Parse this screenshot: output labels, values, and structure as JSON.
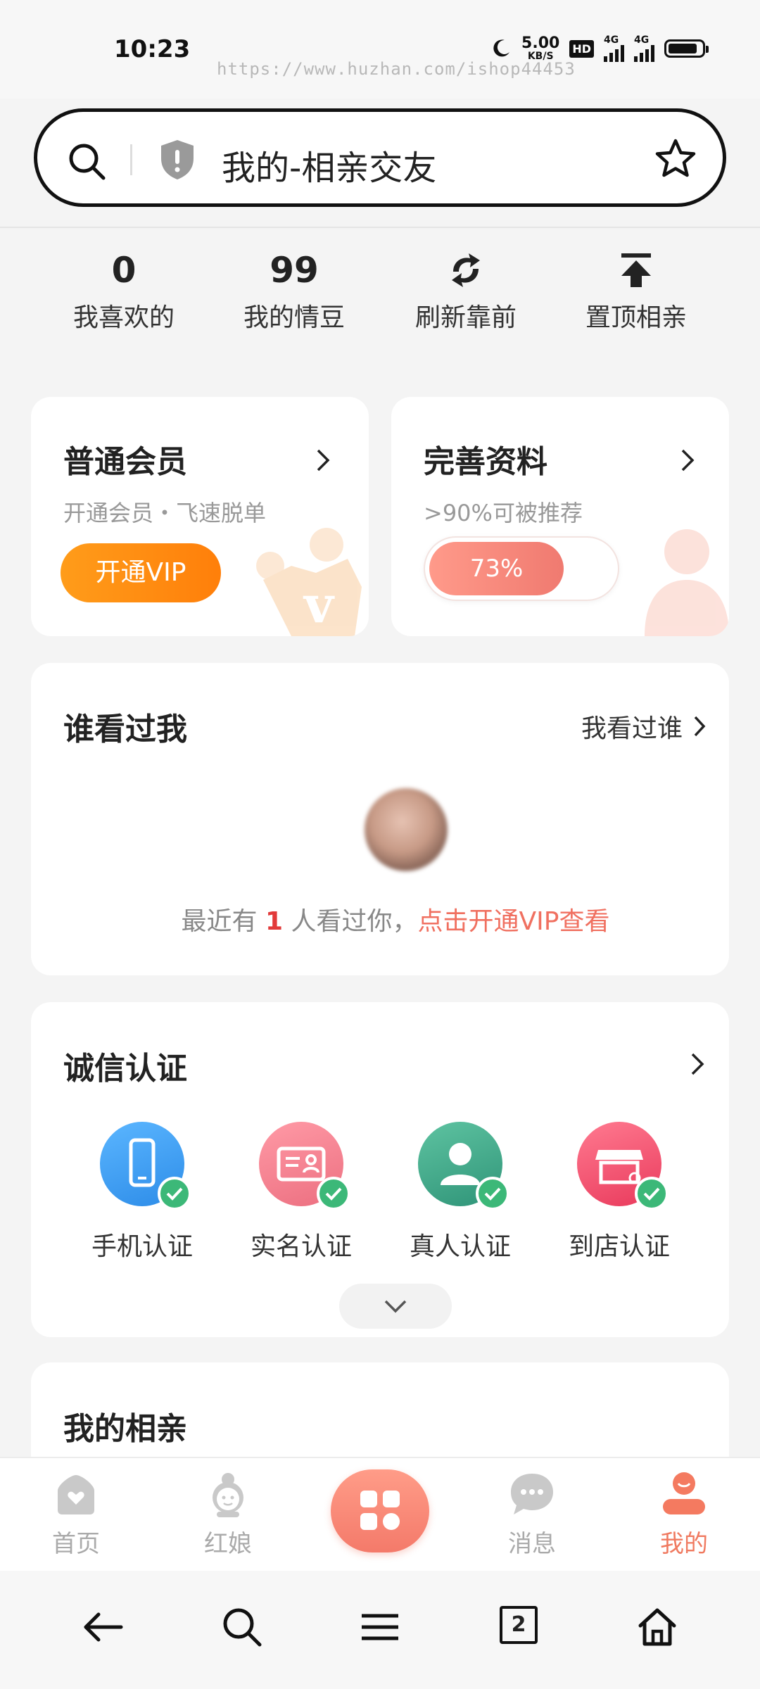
{
  "status": {
    "time": "10:23",
    "speed_value": "5.00",
    "speed_unit": "KB/S",
    "hd": "HD",
    "net1": "4G",
    "net2": "4G",
    "watermark": "https://www.huzhan.com/ishop44453"
  },
  "search": {
    "page_title": "我的-相亲交友",
    "icons": [
      "search-icon",
      "shield-icon",
      "star-icon"
    ]
  },
  "stats": [
    {
      "value": "0",
      "label": "我喜欢的"
    },
    {
      "value": "99",
      "label": "我的情豆"
    },
    {
      "icon": "refresh-icon",
      "label": "刷新靠前"
    },
    {
      "icon": "pin-top-icon",
      "label": "置顶相亲"
    }
  ],
  "membership": {
    "title": "普通会员",
    "subtitle": "开通会员・飞速脱单",
    "button": "开通VIP"
  },
  "profile": {
    "title": "完善资料",
    "subtitle": ">90%可被推荐",
    "progress_label": "73%",
    "progress_value": 0.73
  },
  "visitors": {
    "title": "谁看过我",
    "link": "我看过谁",
    "text_prefix": "最近有",
    "count": "1",
    "text_suffix": "人看过你，",
    "cta": "点击开通VIP查看"
  },
  "certification": {
    "title": "诚信认证",
    "items": [
      {
        "label": "手机认证",
        "icon": "phone-icon",
        "color": "#3a9df0"
      },
      {
        "label": "实名认证",
        "icon": "id-card-icon",
        "color": "#f2788a"
      },
      {
        "label": "真人认证",
        "icon": "person-icon",
        "color": "#3ea58a"
      },
      {
        "label": "到店认证",
        "icon": "store-icon",
        "color": "#f04f6c"
      }
    ]
  },
  "my_dating": {
    "title": "我的相亲"
  },
  "tabbar": {
    "items": [
      {
        "label": "首页",
        "icon": "home-heart-icon"
      },
      {
        "label": "红娘",
        "icon": "matchmaker-icon"
      },
      {
        "label": "",
        "icon": "apps-grid-icon"
      },
      {
        "label": "消息",
        "icon": "chat-icon"
      },
      {
        "label": "我的",
        "icon": "profile-icon",
        "active": true
      }
    ],
    "accent": "#f07a60"
  },
  "browser_nav": {
    "tab_count": "2",
    "icons": [
      "back-arrow-icon",
      "search-icon",
      "menu-icon",
      "tabs-icon",
      "home-icon"
    ]
  }
}
